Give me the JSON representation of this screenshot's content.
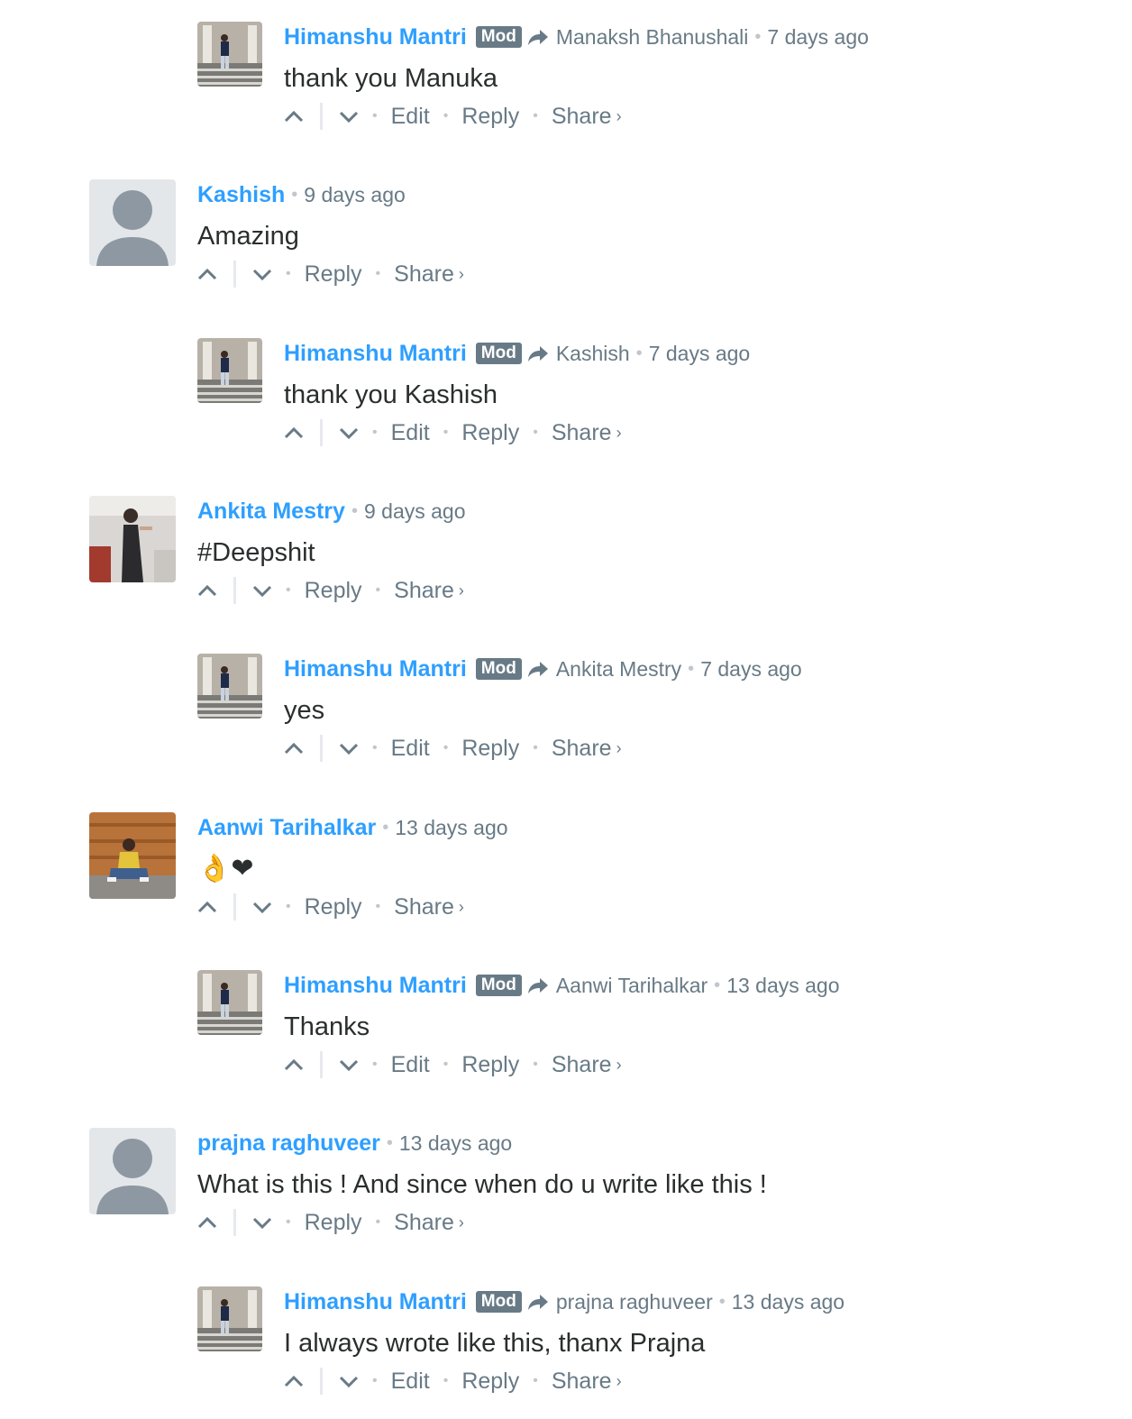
{
  "labels": {
    "mod": "Mod",
    "edit": "Edit",
    "reply": "Reply",
    "share": "Share",
    "share_chevron": "›"
  },
  "comments": [
    {
      "author": "Himanshu Mantri",
      "reply_to": "Manaksh Bhanushali",
      "time": "7 days ago",
      "text": "thank you Manuka"
    },
    {
      "author": "Kashish",
      "time": "9 days ago",
      "text": "Amazing"
    },
    {
      "author": "Himanshu Mantri",
      "reply_to": "Kashish",
      "time": "7 days ago",
      "text": "thank you Kashish"
    },
    {
      "author": "Ankita Mestry",
      "time": "9 days ago",
      "text": "#Deepshit"
    },
    {
      "author": "Himanshu Mantri",
      "reply_to": "Ankita Mestry",
      "time": "7 days ago",
      "text": "yes"
    },
    {
      "author": "Aanwi Tarihalkar",
      "time": "13 days ago",
      "text": "👌❤"
    },
    {
      "author": "Himanshu Mantri",
      "reply_to": "Aanwi Tarihalkar",
      "time": "13 days ago",
      "text": "Thanks"
    },
    {
      "author": "prajna raghuveer",
      "time": "13 days ago",
      "text": "What is this ! And since when do u write like this !"
    },
    {
      "author": "Himanshu Mantri",
      "reply_to": "prajna raghuveer",
      "time": "13 days ago",
      "text": "I always wrote like this, thanx Prajna"
    }
  ],
  "colors": {
    "author": "#2e9fff",
    "meta": "#687a86",
    "mod_badge": "#687a86",
    "text": "#2a2e2e",
    "divider": "#e7e9ee"
  },
  "icons": {
    "upvote": "chevron-up-icon",
    "downvote": "chevron-down-icon",
    "reply_to": "reply-arrow-icon"
  }
}
